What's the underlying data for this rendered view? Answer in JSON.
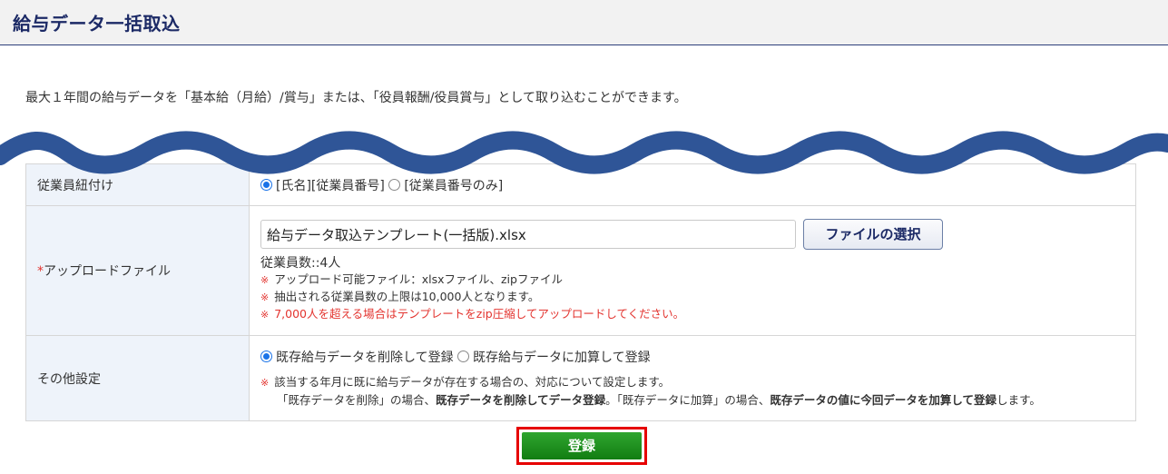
{
  "header": {
    "title": "給与データ一括取込"
  },
  "intro": "最大１年間の給与データを「基本給（月給）/賞与」または、「役員報酬/役員賞与」として取り込むことができます。",
  "rows": {
    "employee_link": {
      "label": "従業員紐付け",
      "option1": "[氏名][従業員番号]",
      "option2": "[従業員番号のみ]",
      "selected": "option1"
    },
    "upload": {
      "required_mark": "*",
      "label": "アップロードファイル",
      "file_value": "給与データ取込テンプレート(一括版).xlsx",
      "file_button": "ファイルの選択",
      "count": "従業員数::4人",
      "note_mark": "※",
      "notes": [
        "アップロード可能ファイル：xlsxファイル、zipファイル",
        "抽出される従業員数の上限は10,000人となります。",
        "7,000人を超える場合はテンプレートをzip圧縮してアップロードしてください。"
      ]
    },
    "other": {
      "label": "その他設定",
      "option1": "既存給与データを削除して登録",
      "option2": "既存給与データに加算して登録",
      "selected": "option1",
      "note_line1": "該当する年月に既に給与データが存在する場合の、対応について設定します。",
      "note_line2": {
        "p1": "「既存データを削除」の場合、",
        "b1": "既存データを削除してデータ登録",
        "p2": "。「既存データに加算」の場合、",
        "b2": "既存データの値に今回データを加算して登録",
        "p3": "します。"
      }
    }
  },
  "submit_label": "登録",
  "colors": {
    "accent": "#1c2a66",
    "wave": "#2f5597",
    "submit": "#1a8c1a",
    "highlight": "#e60000",
    "required": "#e3342f"
  }
}
